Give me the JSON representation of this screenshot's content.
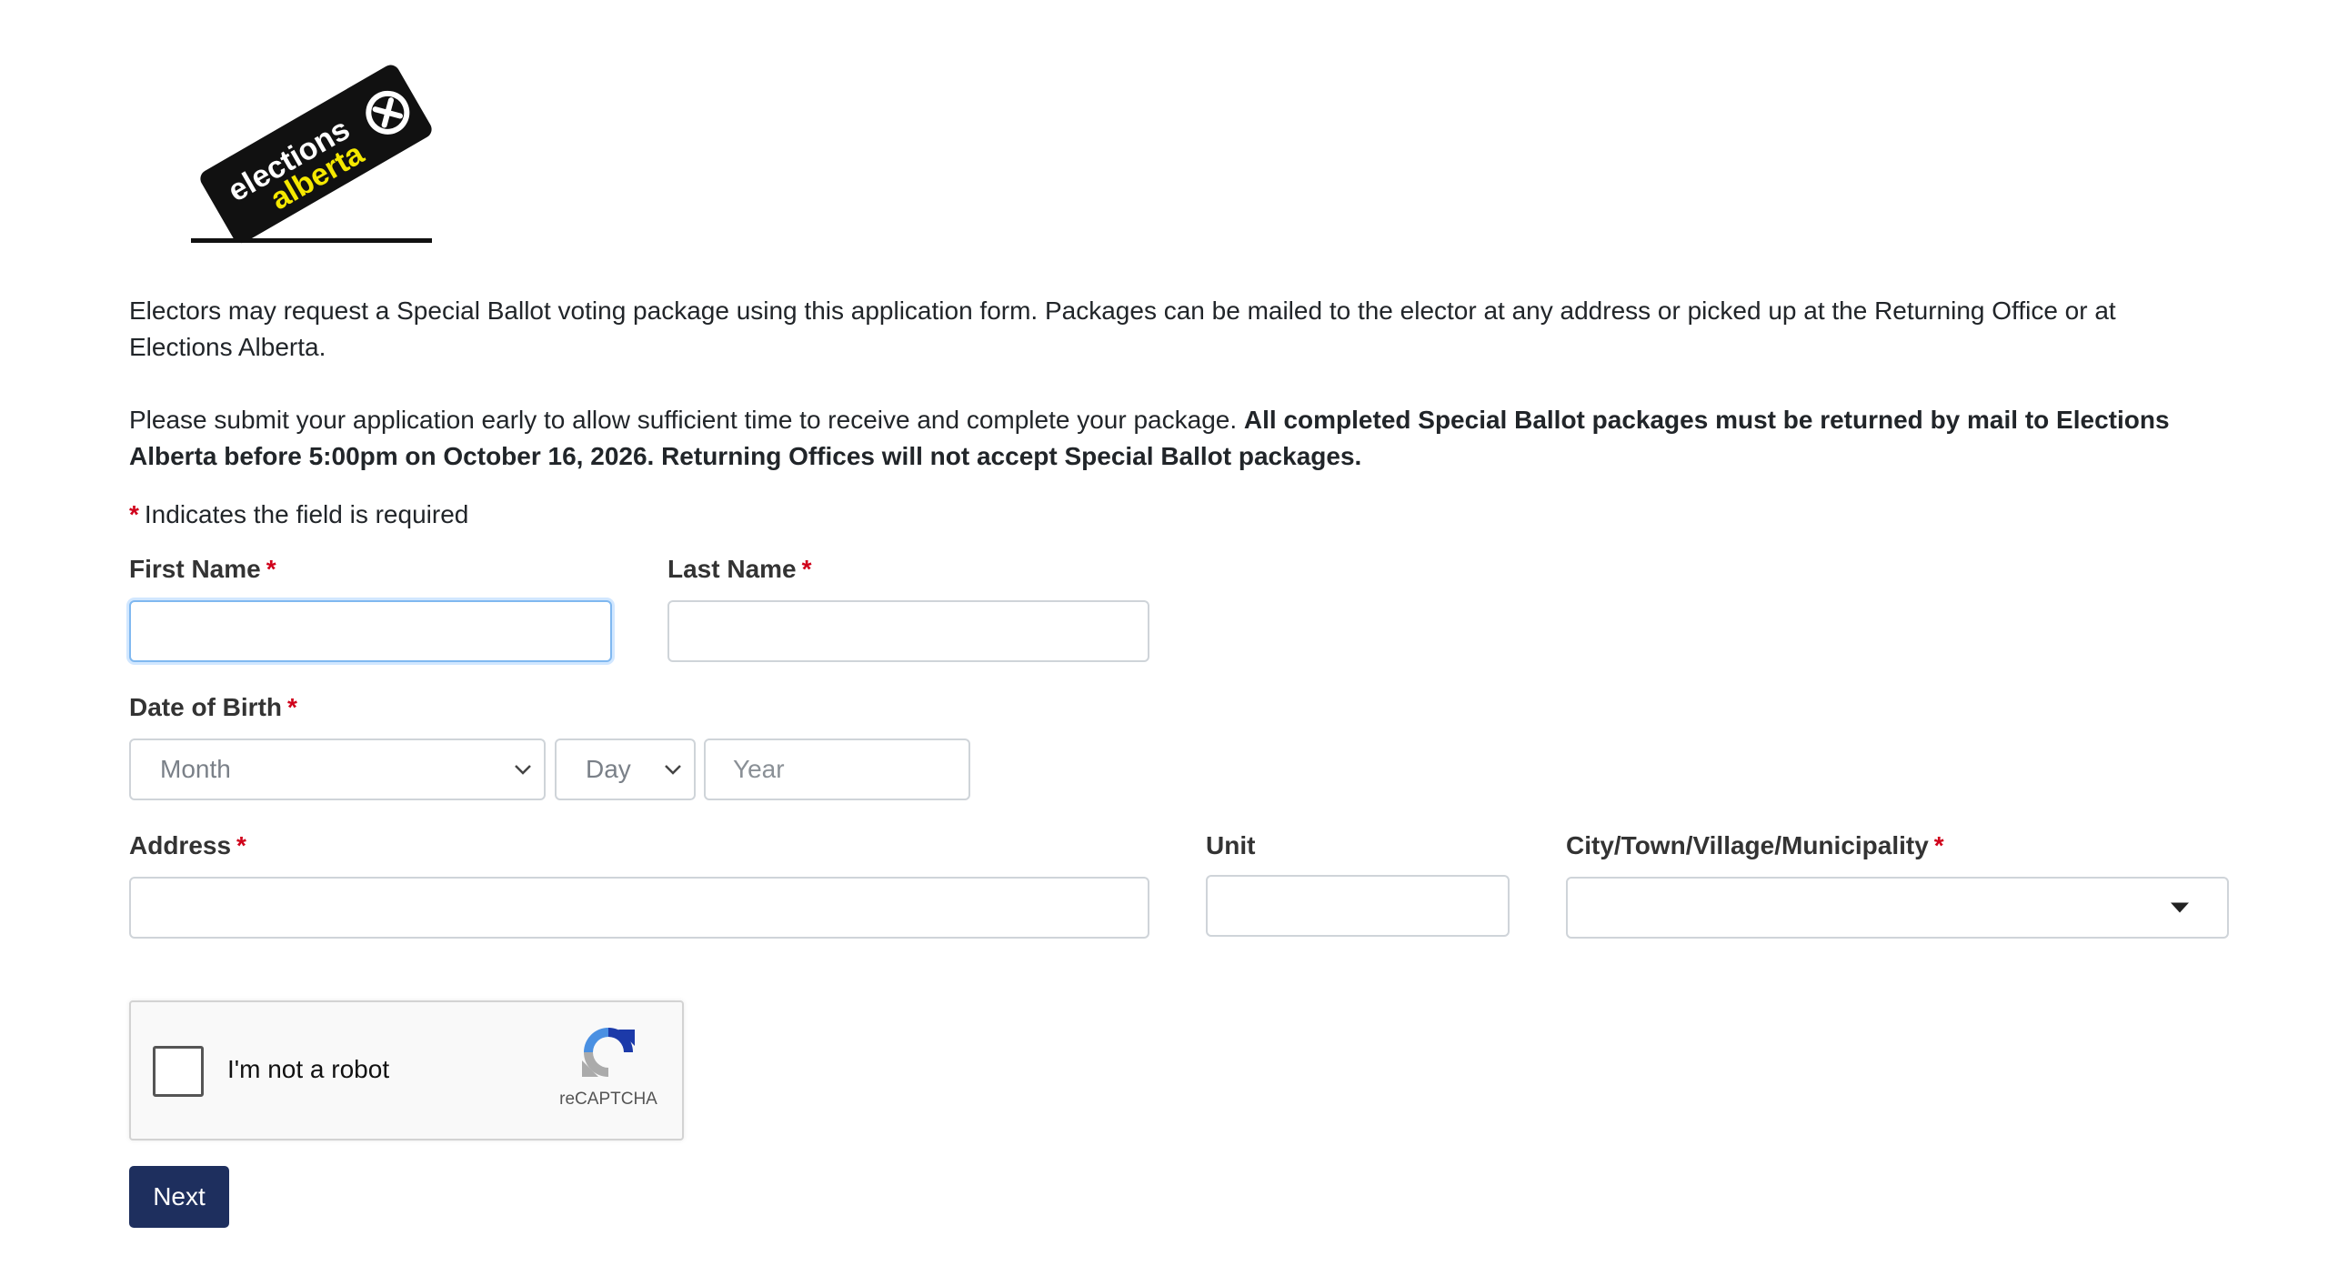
{
  "logo": {
    "line1": "elections",
    "line2": "alberta"
  },
  "intro": {
    "paragraph1": "Electors may request a Special Ballot voting package using this application form. Packages can be mailed to the elector at any address or picked up at the Returning Office or at Elections Alberta.",
    "paragraph2_regular": "Please submit your application early to allow sufficient time to receive and complete your package. ",
    "paragraph2_bold": "All completed Special Ballot packages must be returned by mail to Elections Alberta before 5:00pm on October 16, 2026. Returning Offices will not accept Special Ballot packages."
  },
  "required_note": {
    "marker": "*",
    "text": "Indicates the field is required"
  },
  "form": {
    "first_name": {
      "label": "First Name",
      "required": "*",
      "value": ""
    },
    "last_name": {
      "label": "Last Name",
      "required": "*",
      "value": ""
    },
    "dob": {
      "label": "Date of Birth",
      "required": "*",
      "month_placeholder": "Month",
      "day_placeholder": "Day",
      "year_placeholder": "Year"
    },
    "address": {
      "label": "Address",
      "required": "*",
      "value": ""
    },
    "unit": {
      "label": "Unit",
      "value": ""
    },
    "city": {
      "label": "City/Town/Village/Municipality",
      "required": "*",
      "value": ""
    }
  },
  "captcha": {
    "label": "I'm not a robot",
    "brand": "reCAPTCHA"
  },
  "next_button": {
    "label": "Next"
  },
  "colors": {
    "required_star": "#d0021b",
    "button_bg": "#1e2f5e",
    "focus_border": "#80b8f0"
  }
}
